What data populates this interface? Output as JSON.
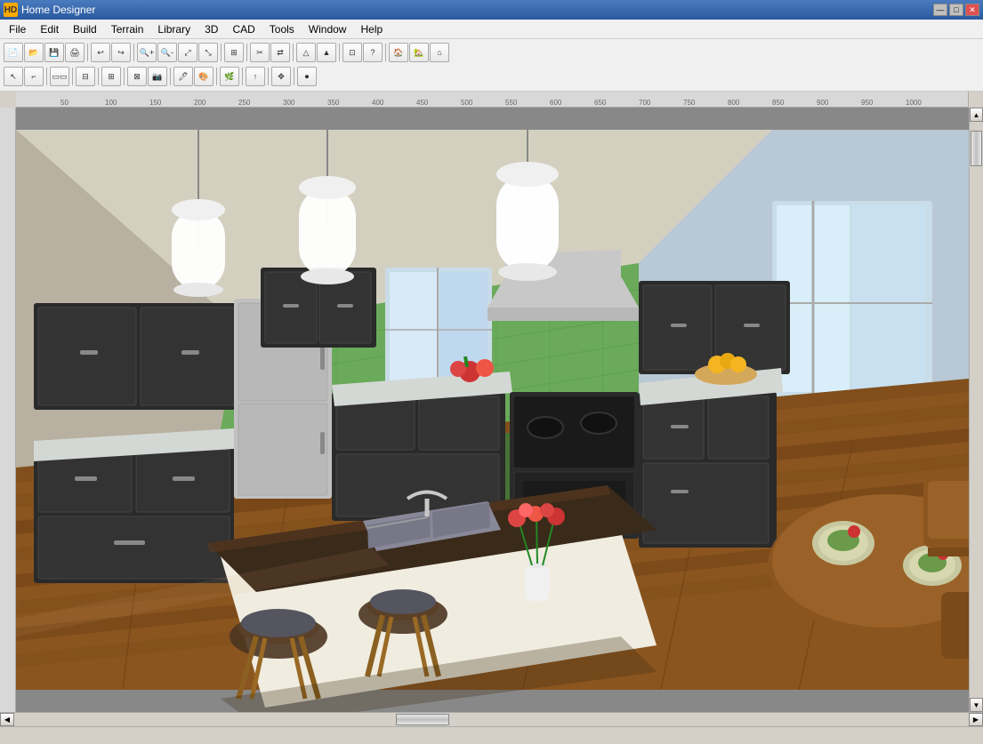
{
  "window": {
    "title": "Home Designer",
    "icon": "HD"
  },
  "titlebar": {
    "minimize_label": "—",
    "maximize_label": "□",
    "close_label": "✕"
  },
  "menubar": {
    "items": [
      {
        "id": "file",
        "label": "File"
      },
      {
        "id": "edit",
        "label": "Edit"
      },
      {
        "id": "build",
        "label": "Build"
      },
      {
        "id": "terrain",
        "label": "Terrain"
      },
      {
        "id": "library",
        "label": "Library"
      },
      {
        "id": "3d",
        "label": "3D"
      },
      {
        "id": "cad",
        "label": "CAD"
      },
      {
        "id": "tools",
        "label": "Tools"
      },
      {
        "id": "window",
        "label": "Window"
      },
      {
        "id": "help",
        "label": "Help"
      }
    ]
  },
  "toolbar1": {
    "buttons": [
      {
        "id": "new",
        "icon": "📄",
        "tooltip": "New"
      },
      {
        "id": "open",
        "icon": "📂",
        "tooltip": "Open"
      },
      {
        "id": "save",
        "icon": "💾",
        "tooltip": "Save"
      },
      {
        "id": "print",
        "icon": "🖨",
        "tooltip": "Print"
      },
      {
        "id": "sep1",
        "type": "separator"
      },
      {
        "id": "undo",
        "icon": "↩",
        "tooltip": "Undo"
      },
      {
        "id": "redo",
        "icon": "↪",
        "tooltip": "Redo"
      },
      {
        "id": "sep2",
        "type": "separator"
      },
      {
        "id": "zoom-in",
        "icon": "🔍+",
        "tooltip": "Zoom In"
      },
      {
        "id": "zoom-out",
        "icon": "🔍-",
        "tooltip": "Zoom Out"
      },
      {
        "id": "zoom-fit",
        "icon": "⤢",
        "tooltip": "Fit to Window"
      },
      {
        "id": "zoom-prev",
        "icon": "⤡",
        "tooltip": "Previous Zoom"
      },
      {
        "id": "sep3",
        "type": "separator"
      },
      {
        "id": "fill-window",
        "icon": "⊞",
        "tooltip": "Fill Window"
      },
      {
        "id": "sep4",
        "type": "separator"
      },
      {
        "id": "tool1",
        "icon": "✂",
        "tooltip": "Cut"
      },
      {
        "id": "tool2",
        "icon": "⇄",
        "tooltip": "Flip"
      },
      {
        "id": "sep5",
        "type": "separator"
      },
      {
        "id": "tool3",
        "icon": "△",
        "tooltip": "Triangle"
      },
      {
        "id": "tool4",
        "icon": "▲",
        "tooltip": "Arrow Up"
      },
      {
        "id": "sep6",
        "type": "separator"
      },
      {
        "id": "tool5",
        "icon": "⊡",
        "tooltip": "Grid"
      },
      {
        "id": "tool6",
        "icon": "?",
        "tooltip": "Help"
      },
      {
        "id": "sep7",
        "type": "separator"
      },
      {
        "id": "house1",
        "icon": "🏠",
        "tooltip": "Floor Plan"
      },
      {
        "id": "house2",
        "icon": "🏡",
        "tooltip": "3D View"
      },
      {
        "id": "house3",
        "icon": "⌂",
        "tooltip": "Perspective"
      }
    ]
  },
  "toolbar2": {
    "buttons": [
      {
        "id": "select",
        "icon": "↖",
        "tooltip": "Select"
      },
      {
        "id": "draw-wall",
        "icon": "⌐",
        "tooltip": "Draw Wall"
      },
      {
        "id": "sep1",
        "type": "separator"
      },
      {
        "id": "wall-type",
        "icon": "▭▭",
        "tooltip": "Wall Type"
      },
      {
        "id": "sep2",
        "type": "separator"
      },
      {
        "id": "cabinet",
        "icon": "⊟",
        "tooltip": "Cabinet"
      },
      {
        "id": "sep3",
        "type": "separator"
      },
      {
        "id": "floor-plan",
        "icon": "⊞",
        "tooltip": "Floor Plan"
      },
      {
        "id": "sep4",
        "type": "separator"
      },
      {
        "id": "appliance",
        "icon": "⊠",
        "tooltip": "Appliance"
      },
      {
        "id": "camera",
        "icon": "📷",
        "tooltip": "Camera"
      },
      {
        "id": "sep5",
        "type": "separator"
      },
      {
        "id": "paint",
        "icon": "🖊",
        "tooltip": "Paint"
      },
      {
        "id": "texture",
        "icon": "🎨",
        "tooltip": "Texture"
      },
      {
        "id": "sep6",
        "type": "separator"
      },
      {
        "id": "plant",
        "icon": "🌿",
        "tooltip": "Plant"
      },
      {
        "id": "sep7",
        "type": "separator"
      },
      {
        "id": "arrow-up",
        "icon": "↑",
        "tooltip": "Arrow Up"
      },
      {
        "id": "sep8",
        "type": "separator"
      },
      {
        "id": "move",
        "icon": "✥",
        "tooltip": "Move"
      },
      {
        "id": "sep9",
        "type": "separator"
      },
      {
        "id": "record",
        "icon": "⏺",
        "tooltip": "Record"
      }
    ]
  },
  "scene": {
    "description": "3D kitchen render with dark cabinets, green tile backsplash, hardwood floors, kitchen island with sink, pendant lights, bar stools"
  },
  "scrollbar": {
    "vertical_arrow_up": "▲",
    "vertical_arrow_down": "▼",
    "horizontal_arrow_left": "◀",
    "horizontal_arrow_right": "▶"
  }
}
